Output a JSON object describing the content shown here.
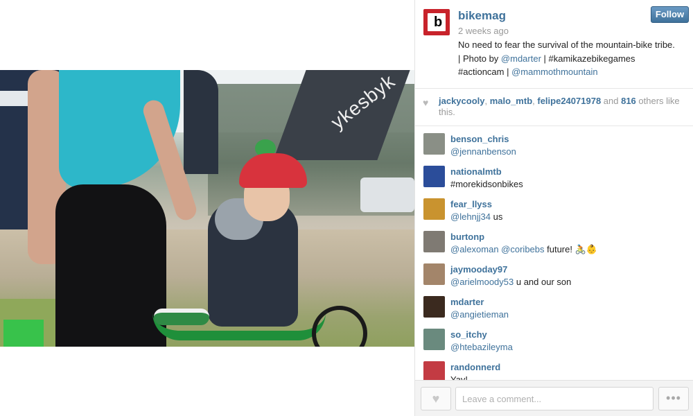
{
  "post": {
    "username": "bikemag",
    "time": "2 weeks ago",
    "follow_label": "Follow",
    "caption": {
      "line1": "No need to fear the survival of the mountain-bike tribe.",
      "line2_prefix": "| Photo by ",
      "mention_photographer": "@mdarter",
      "line2_suffix": " | #kamikazebikegames",
      "line3_prefix": "#actioncam | ",
      "mention_location": "@mammothmountain"
    },
    "photo_banner_text": "ykesbyk"
  },
  "likes": {
    "users": [
      "jackycooly",
      "malo_mtb",
      "felipe24071978"
    ],
    "separator": ", ",
    "and_text": " and ",
    "count": "816",
    "suffix": " others like this."
  },
  "comments": [
    {
      "user": "benson_chris",
      "mention": "@jennanbenson",
      "text": "",
      "thumb_color": "#8a8f86"
    },
    {
      "user": "nationalmtb",
      "mention": "",
      "text": "#morekidsonbikes",
      "thumb_color": "#2b4d9a"
    },
    {
      "user": "fear_llyss",
      "mention": "@lehnjj34",
      "text": " us",
      "thumb_color": "#c9932f"
    },
    {
      "user": "burtonp",
      "mention": "@alexoman @coribebs",
      "text": " future! 🚴👶",
      "thumb_color": "#7f7a73"
    },
    {
      "user": "jaymooday97",
      "mention": "@arielmoody53",
      "text": " u and our son",
      "thumb_color": "#a3856a"
    },
    {
      "user": "mdarter",
      "mention": "@angietieman",
      "text": "",
      "thumb_color": "#3b2a1f"
    },
    {
      "user": "so_itchy",
      "mention": "@htebazileyma",
      "text": "",
      "thumb_color": "#6a8a7e"
    },
    {
      "user": "randonnerd",
      "mention": "",
      "text": "Yay!",
      "thumb_color": "#c33b43"
    }
  ],
  "footer": {
    "comment_placeholder": "Leave a comment...",
    "more_label": "•••",
    "like_icon": "heart-icon"
  },
  "colors": {
    "link": "#3f729b",
    "follow_bg": "#3f729b",
    "brand_red": "#c8232b"
  }
}
